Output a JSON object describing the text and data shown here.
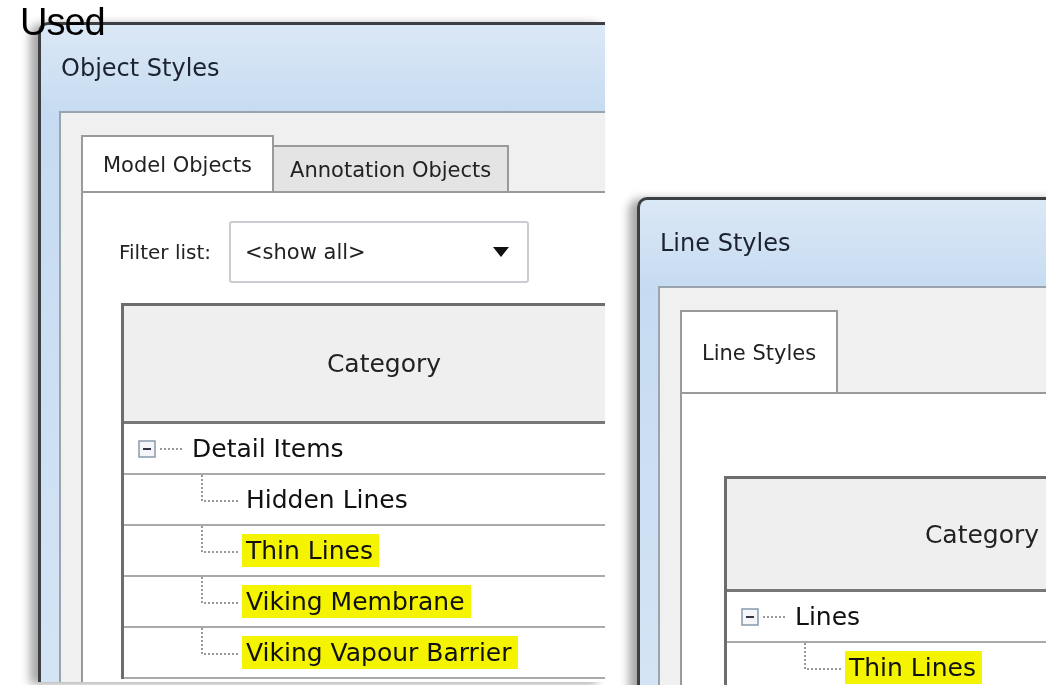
{
  "caption": "Used",
  "windows": [
    {
      "title": "Object Styles",
      "tabs": [
        {
          "label": "Model Objects",
          "selected": true
        },
        {
          "label": "Annotation Objects",
          "selected": false
        }
      ],
      "filter": {
        "label": "Filter list:",
        "value": "<show all>"
      },
      "table": {
        "columns": [
          "Category"
        ],
        "tree": [
          {
            "label": "Detail Items",
            "expanded": true,
            "highlighted": false,
            "children": [
              {
                "label": "Hidden Lines",
                "highlighted": false
              },
              {
                "label": "Thin Lines",
                "highlighted": true
              },
              {
                "label": "Viking Membrane",
                "highlighted": true
              },
              {
                "label": "Viking Vapour Barrier",
                "highlighted": true
              }
            ]
          }
        ]
      }
    },
    {
      "title": "Line Styles",
      "tabs": [
        {
          "label": "Line Styles",
          "selected": true
        }
      ],
      "table": {
        "columns": [
          "Category"
        ],
        "tree": [
          {
            "label": "Lines",
            "expanded": true,
            "highlighted": false,
            "children": [
              {
                "label": "Thin Lines",
                "highlighted": true
              }
            ]
          }
        ]
      }
    }
  ]
}
